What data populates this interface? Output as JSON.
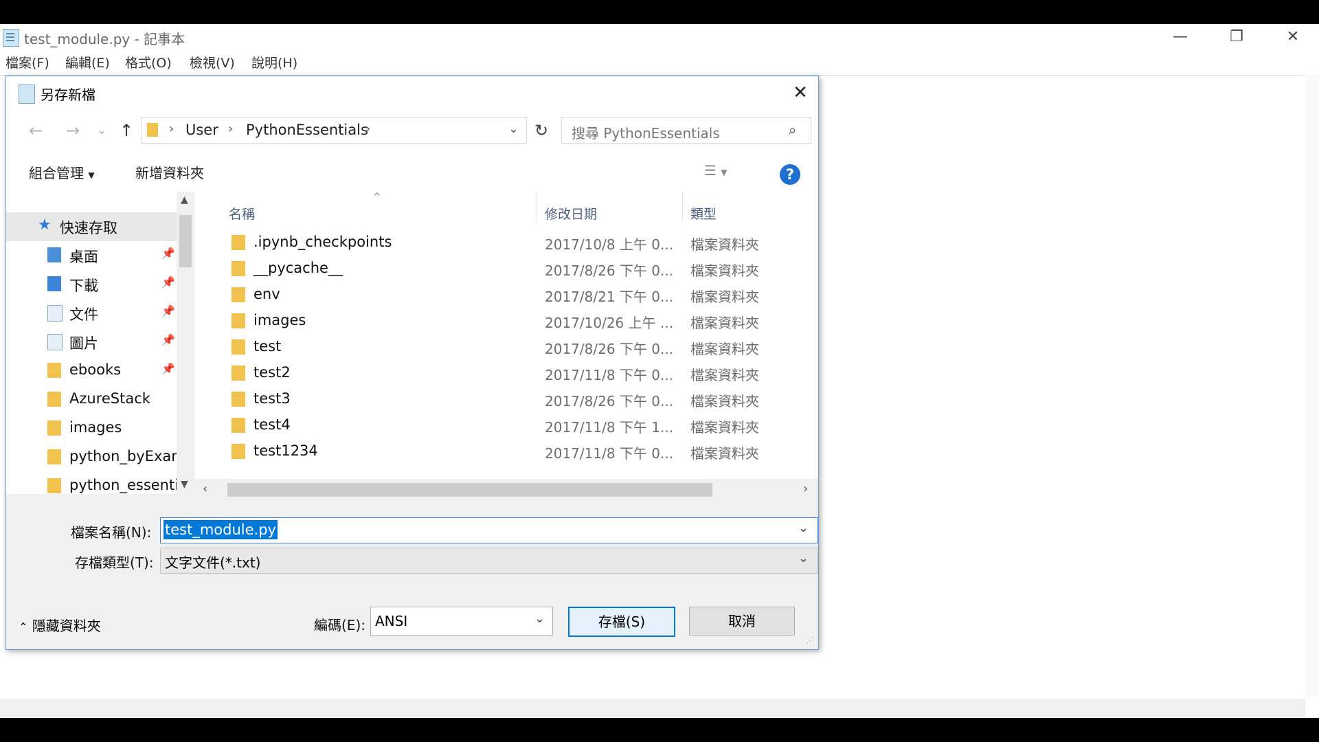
{
  "notepad": {
    "title": "test_module.py - 記事本",
    "menu": [
      "檔案(F)",
      "編輯(E)",
      "格式(O)",
      "檢視(V)",
      "說明(H)"
    ],
    "window_buttons": {
      "minimize": "—",
      "maximize": "❐",
      "close": "✕"
    }
  },
  "dialog": {
    "title": "另存新檔",
    "close": "✕",
    "nav": {
      "back": "←",
      "forward": "→",
      "recent": "⌄",
      "up": "↑",
      "refresh": "↻"
    },
    "breadcrumb": [
      "User",
      "PythonEssentials"
    ],
    "search_placeholder": "搜尋 PythonEssentials",
    "toolbar": {
      "organize": "組合管理",
      "new_folder": "新增資料夾",
      "help": "?"
    },
    "nav_pane": [
      {
        "label": "快速存取",
        "pinned": false,
        "icon": "star-icon"
      },
      {
        "label": "桌面",
        "pinned": true,
        "icon": "desktop-icon"
      },
      {
        "label": "下載",
        "pinned": true,
        "icon": "download-icon"
      },
      {
        "label": "文件",
        "pinned": true,
        "icon": "documents-icon"
      },
      {
        "label": "圖片",
        "pinned": true,
        "icon": "pictures-icon"
      },
      {
        "label": "ebooks",
        "pinned": true,
        "icon": "folder-icon"
      },
      {
        "label": "AzureStack",
        "pinned": false,
        "icon": "folder-icon"
      },
      {
        "label": "images",
        "pinned": false,
        "icon": "folder-icon"
      },
      {
        "label": "python_byExam",
        "pinned": false,
        "icon": "folder-icon"
      },
      {
        "label": "python_essentia",
        "pinned": false,
        "icon": "folder-icon"
      }
    ],
    "columns": {
      "name": "名稱",
      "date": "修改日期",
      "type": "類型"
    },
    "files": [
      {
        "name": ".ipynb_checkpoints",
        "date": "2017/10/8 上午 0...",
        "type": "檔案資料夾"
      },
      {
        "name": "__pycache__",
        "date": "2017/8/26 下午 0...",
        "type": "檔案資料夾"
      },
      {
        "name": "env",
        "date": "2017/8/21 下午 0...",
        "type": "檔案資料夾"
      },
      {
        "name": "images",
        "date": "2017/10/26 上午 ...",
        "type": "檔案資料夾"
      },
      {
        "name": "test",
        "date": "2017/8/26 下午 0...",
        "type": "檔案資料夾"
      },
      {
        "name": "test2",
        "date": "2017/11/8 下午 0...",
        "type": "檔案資料夾"
      },
      {
        "name": "test3",
        "date": "2017/8/26 下午 0...",
        "type": "檔案資料夾"
      },
      {
        "name": "test4",
        "date": "2017/11/8 下午 1...",
        "type": "檔案資料夾"
      },
      {
        "name": "test1234",
        "date": "2017/11/8 下午 0...",
        "type": "檔案資料夾"
      }
    ],
    "filename_label": "檔案名稱(N):",
    "filename_value": "test_module.py",
    "filetype_label": "存檔類型(T):",
    "filetype_value": "文字文件(*.txt)",
    "hide_folders": "隱藏資料夾",
    "encoding_label": "編碼(E):",
    "encoding_value": "ANSI",
    "save_button": "存檔(S)",
    "cancel_button": "取消"
  },
  "colors": {
    "accent": "#0078d7",
    "folder": "#f2c24f",
    "help": "#1f6fd1"
  }
}
